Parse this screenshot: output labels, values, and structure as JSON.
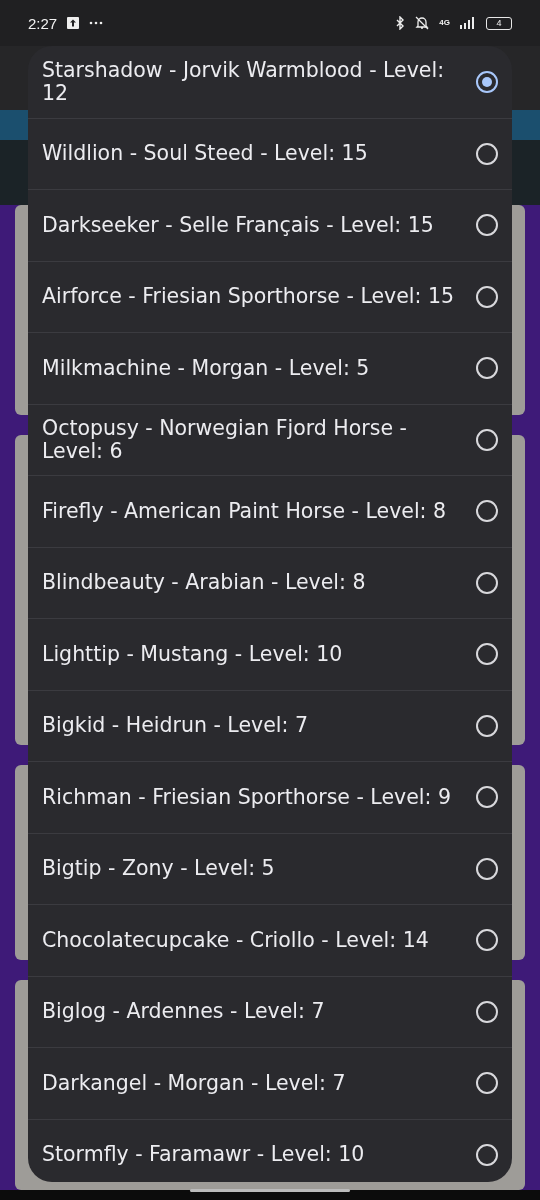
{
  "status_bar": {
    "time": "2:27",
    "network": "4G",
    "battery": "4"
  },
  "options": [
    {
      "label": "Starshadow - Jorvik Warmblood - Level: 12",
      "selected": true
    },
    {
      "label": "Wildlion - Soul Steed - Level: 15",
      "selected": false
    },
    {
      "label": "Darkseeker - Selle Français - Level: 15",
      "selected": false
    },
    {
      "label": "Airforce - Friesian Sporthorse - Level: 15",
      "selected": false
    },
    {
      "label": "Milkmachine - Morgan - Level: 5",
      "selected": false
    },
    {
      "label": "Octopusy - Norwegian Fjord Horse - Level: 6",
      "selected": false
    },
    {
      "label": "Firefly - American Paint Horse - Level: 8",
      "selected": false
    },
    {
      "label": "Blindbeauty - Arabian - Level: 8",
      "selected": false
    },
    {
      "label": "Lighttip - Mustang - Level: 10",
      "selected": false
    },
    {
      "label": "Bigkid - Heidrun - Level: 7",
      "selected": false
    },
    {
      "label": "Richman - Friesian Sporthorse - Level: 9",
      "selected": false
    },
    {
      "label": "Bigtip - Zony - Level: 5",
      "selected": false
    },
    {
      "label": "Chocolatecupcake - Criollo - Level: 14",
      "selected": false
    },
    {
      "label": "Biglog - Ardennes - Level: 7",
      "selected": false
    },
    {
      "label": "Darkangel - Morgan - Level: 7",
      "selected": false
    },
    {
      "label": "Stormfly - Faramawr - Level: 10",
      "selected": false
    }
  ]
}
